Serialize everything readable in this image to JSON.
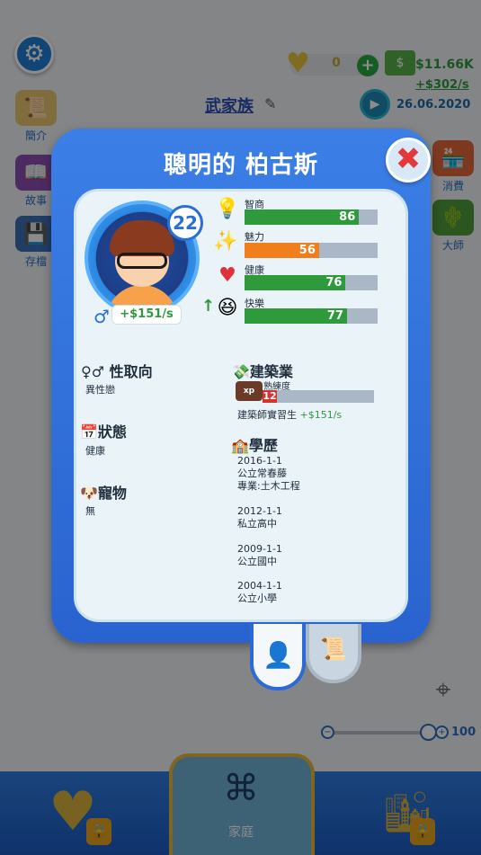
{
  "header": {
    "heart_count": "0",
    "money": "$11.66K",
    "income_rate": "+$302/s",
    "date": "26.06.2020",
    "family_name": "武家族"
  },
  "sidebar": {
    "items": [
      {
        "label": "簡介",
        "icon": "scroll-icon"
      },
      {
        "label": "故事",
        "icon": "book-icon"
      },
      {
        "label": "存檔",
        "icon": "save-icon"
      }
    ]
  },
  "right_side": {
    "items": [
      {
        "label": "消費",
        "icon": "shop-icon"
      },
      {
        "label": "大師",
        "icon": "cactus-icon"
      }
    ]
  },
  "zoom": {
    "value": "100"
  },
  "bottom_nav": {
    "family_label": "家庭"
  },
  "modal": {
    "title": "聰明的 柏古斯",
    "age": "22",
    "income": "+$151/s",
    "stats": [
      {
        "label": "智商",
        "value": 86,
        "color": "#2e9a3c",
        "icon": "lightbulb-icon"
      },
      {
        "label": "魅力",
        "value": 56,
        "color": "#f07e1c",
        "icon": "charm-icon"
      },
      {
        "label": "健康",
        "value": 76,
        "color": "#2e9a3c",
        "icon": "heart-icon"
      },
      {
        "label": "快樂",
        "value": 77,
        "color": "#2e9a3c",
        "icon": "happy-face-icon"
      }
    ],
    "orientation": {
      "heading": "性取向",
      "value": "異性戀"
    },
    "status": {
      "heading": "狀態",
      "value": "健康"
    },
    "pet": {
      "heading": "寵物",
      "value": "無"
    },
    "career": {
      "heading": "建築業",
      "proficiency_label": "熟練度",
      "level": "12",
      "xp_fill": 0,
      "job_title": "建築師實習生",
      "job_income": "+$151/s"
    },
    "education": {
      "heading": "學歷",
      "entries": [
        {
          "date": "2016-1-1",
          "school": "公立常春藤",
          "major": "專業:土木工程"
        },
        {
          "date": "2012-1-1",
          "school": "私立高中"
        },
        {
          "date": "2009-1-1",
          "school": "公立國中"
        },
        {
          "date": "2004-1-1",
          "school": "公立小學"
        }
      ]
    }
  }
}
